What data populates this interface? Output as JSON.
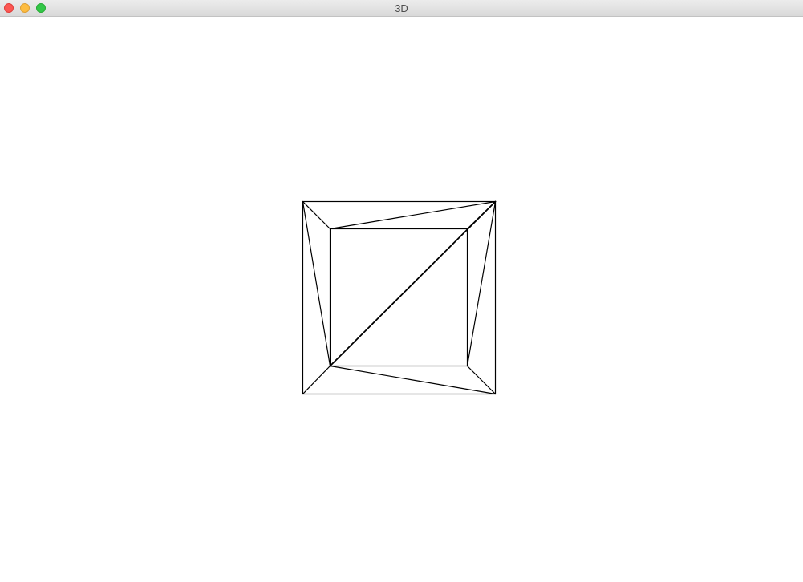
{
  "window": {
    "title": "3D",
    "buttons": {
      "close_color": "#fc5753",
      "minimize_color": "#fdbc40",
      "maximize_color": "#33c748"
    }
  },
  "canvas": {
    "background": "#ffffff",
    "stroke_color": "#000000"
  }
}
